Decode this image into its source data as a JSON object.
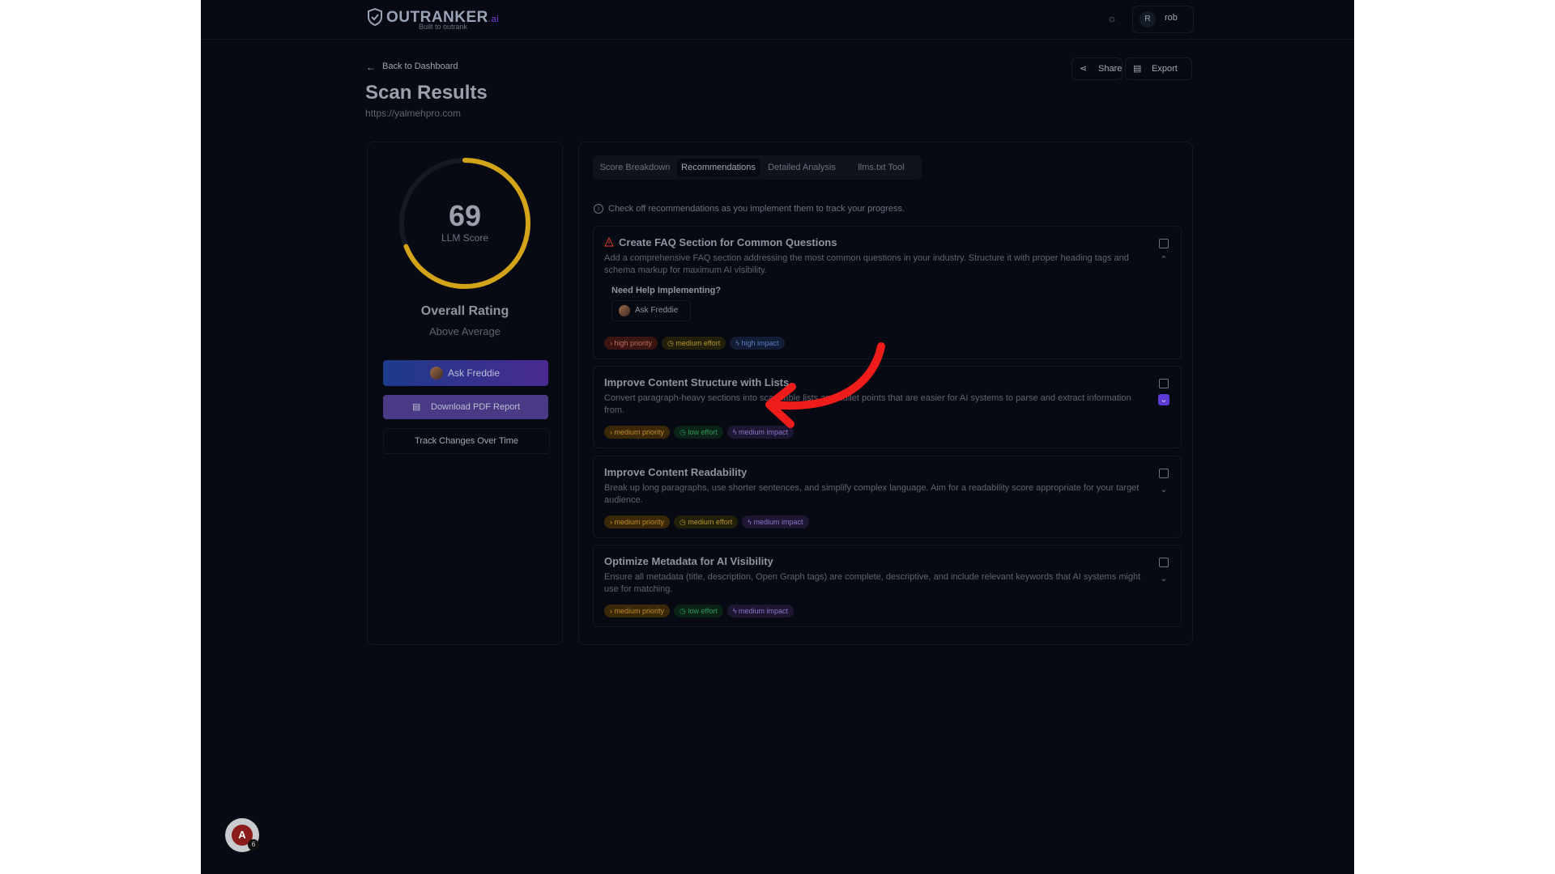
{
  "brand": {
    "name": "OUTRANKER",
    "suffix": ".ai",
    "tagline": "Built to outrank"
  },
  "header": {
    "theme_icon": "sun-icon",
    "user": {
      "initial": "R",
      "name": "rob"
    }
  },
  "page": {
    "back_label": "Back to Dashboard",
    "title": "Scan Results",
    "url": "https://yalmehpro.com",
    "actions": {
      "share": "Share",
      "export": "Export"
    }
  },
  "score": {
    "value": "69",
    "label": "LLM Score",
    "progress": 0.69,
    "rating_title": "Overall Rating",
    "rating_value": "Above Average",
    "gauge_color": "#d4a418"
  },
  "left_actions": {
    "ask": "Ask Freddie",
    "pdf": "Download PDF Report",
    "track": "Track Changes Over Time"
  },
  "tabs": [
    {
      "label": "Score Breakdown",
      "active": false
    },
    {
      "label": "Recommendations",
      "active": true
    },
    {
      "label": "Detailed Analysis",
      "active": false
    },
    {
      "label": "llms.txt Tool",
      "active": false
    }
  ],
  "info": "Check off recommendations as you implement them to track your progress.",
  "recommendations": [
    {
      "title": "Create FAQ Section for Common Questions",
      "description": "Add a comprehensive FAQ section addressing the most common questions in your industry. Structure it with proper heading tags and schema markup for maximum AI visibility.",
      "help_title": "Need Help Implementing?",
      "help_button": "Ask Freddie",
      "tags": {
        "priority": "high priority",
        "effort": "medium effort",
        "impact": "high impact"
      }
    },
    {
      "title": "Improve Content Structure with Lists",
      "description": "Convert paragraph-heavy sections into scannable lists and bullet points that are easier for AI systems to parse and extract information from.",
      "tags": {
        "priority": "medium priority",
        "effort": "low effort",
        "impact": "medium impact"
      }
    },
    {
      "title": "Improve Content Readability",
      "description": "Break up long paragraphs, use shorter sentences, and simplify complex language. Aim for a readability score appropriate for your target audience.",
      "tags": {
        "priority": "medium priority",
        "effort": "medium effort",
        "impact": "medium impact"
      }
    },
    {
      "title": "Optimize Metadata for AI Visibility",
      "description": "Ensure all metadata (title, description, Open Graph tags) are complete, descriptive, and include relevant keywords that AI systems might use for matching.",
      "tags": {
        "priority": "medium priority",
        "effort": "low effort",
        "impact": "medium impact"
      }
    }
  ],
  "widget": {
    "count": "6"
  },
  "colors": {
    "annotation_arrow": "#ef1c1c",
    "accent": "#5b3bd3"
  }
}
